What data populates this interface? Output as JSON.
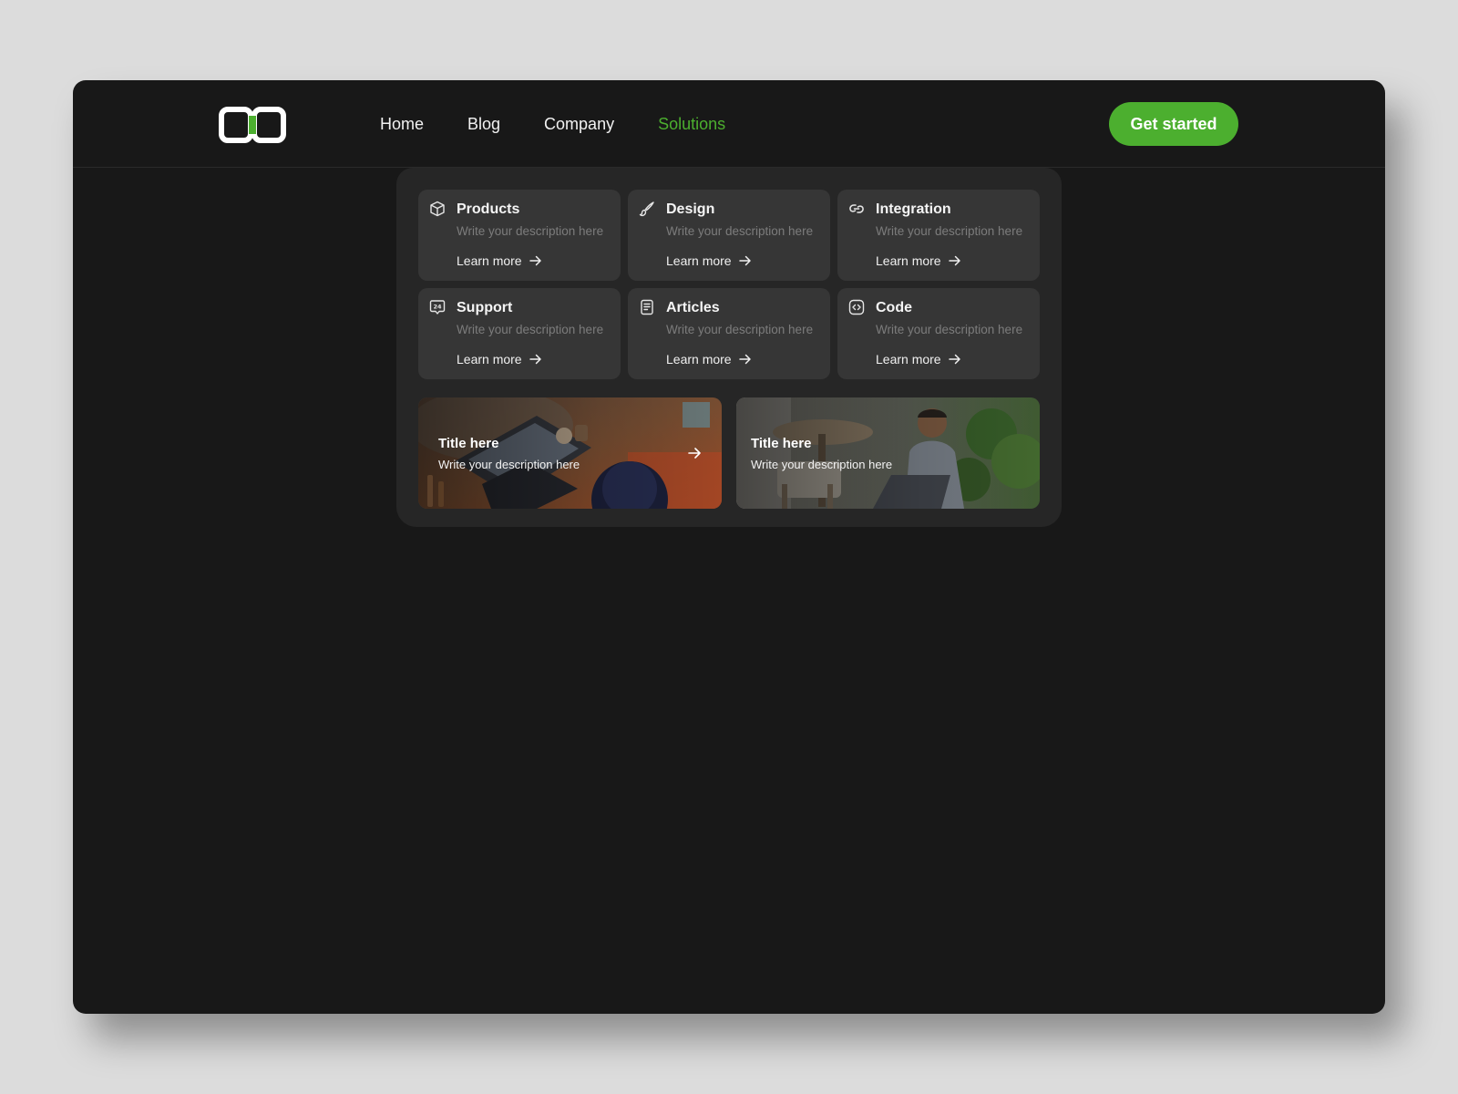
{
  "header": {
    "logo_icon": "brand-logo-icon",
    "nav": [
      {
        "label": "Home",
        "active": false
      },
      {
        "label": "Blog",
        "active": false
      },
      {
        "label": "Company",
        "active": false
      },
      {
        "label": "Solutions",
        "active": true
      }
    ],
    "cta_label": "Get started"
  },
  "colors": {
    "accent": "#4caf2f",
    "window_bg": "#181818",
    "dropdown_bg": "#262626",
    "card_bg": "#363636",
    "page_bg": "#dcdcdc"
  },
  "solutions_menu": {
    "cards": [
      {
        "icon": "box-icon",
        "title": "Products",
        "description": "Write your description here",
        "link": "Learn more"
      },
      {
        "icon": "brush-icon",
        "title": "Design",
        "description": "Write your description here",
        "link": "Learn more"
      },
      {
        "icon": "link-icon",
        "title": "Integration",
        "description": "Write your description here",
        "link": "Learn more"
      },
      {
        "icon": "support-24-icon",
        "title": "Support",
        "description": "Write your description here",
        "link": "Learn more"
      },
      {
        "icon": "document-icon",
        "title": "Articles",
        "description": "Write your description here",
        "link": "Learn more"
      },
      {
        "icon": "code-icon",
        "title": "Code",
        "description": "Write your description here",
        "link": "Learn more"
      }
    ],
    "features": [
      {
        "title": "Title here",
        "description": "Write your description here",
        "image": "desk-laptop-photo",
        "has_arrow": true
      },
      {
        "title": "Title here",
        "description": "Write your description here",
        "image": "man-working-laptop-photo",
        "has_arrow": false
      }
    ]
  }
}
